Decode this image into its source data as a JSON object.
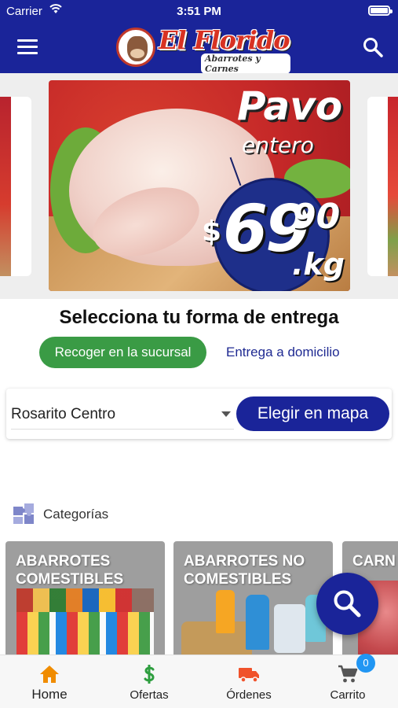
{
  "status_bar": {
    "carrier": "Carrier",
    "time": "3:51 PM"
  },
  "header": {
    "brand_name": "El Florido",
    "brand_tagline": "Abarrotes y Carnes",
    "menu_icon": "hamburger-menu-icon",
    "search_icon": "search-icon",
    "background_color": "#1a2499"
  },
  "carousel": {
    "banner": {
      "title_line1": "Pavo",
      "title_line2": "entero",
      "currency": "$",
      "price_integer": "69",
      "price_decimal": "90",
      "price_unit": ".kg"
    }
  },
  "delivery": {
    "title": "Selecciona tu forma de entrega",
    "pickup_label": "Recoger en la sucursal",
    "home_delivery_label": "Entrega a domicilio",
    "selected_branch": "Rosarito Centro",
    "map_button_label": "Elegir en mapa",
    "pickup_color": "#3a9b45"
  },
  "categories": {
    "header_label": "Categorías",
    "header_icon": "puzzle-icon",
    "items": [
      {
        "label_line1": "ABARROTES",
        "label_line2": "COMESTIBLES"
      },
      {
        "label_line1": "ABARROTES NO",
        "label_line2": "COMESTIBLES"
      },
      {
        "label_line1": "CARN",
        "label_line2": ""
      }
    ]
  },
  "fab": {
    "icon": "search-icon"
  },
  "bottom_nav": {
    "items": [
      {
        "label": "Home",
        "icon": "home-icon",
        "color": "#f08c00"
      },
      {
        "label": "Ofertas",
        "icon": "dollar-icon",
        "color": "#2e9e3f"
      },
      {
        "label": "Órdenes",
        "icon": "truck-icon",
        "color": "#f0522b"
      },
      {
        "label": "Carrito",
        "icon": "cart-icon",
        "color": "#555555"
      }
    ],
    "cart_count": "0"
  }
}
